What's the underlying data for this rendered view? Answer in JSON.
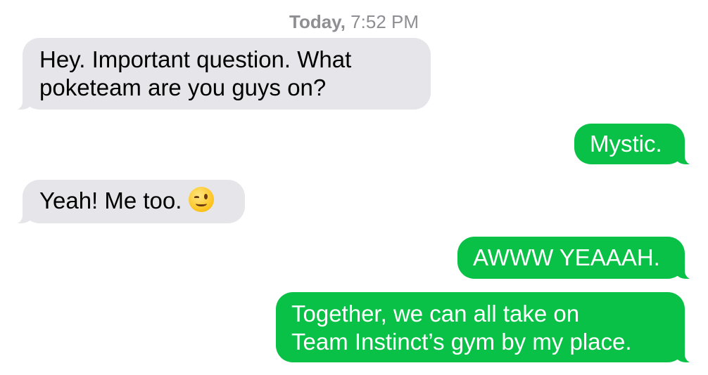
{
  "header": {
    "day": "Today,",
    "time": "7:52 PM"
  },
  "messages": [
    {
      "direction": "incoming",
      "lines": [
        "Hey. Important question. What",
        "poketeam are you guys on?"
      ]
    },
    {
      "direction": "outgoing",
      "lines": [
        "Mystic."
      ]
    },
    {
      "direction": "incoming",
      "lines": [
        "Yeah! Me too."
      ],
      "emoji": "winking-face-emoji"
    },
    {
      "direction": "outgoing",
      "lines": [
        "AWWW YEAAAH."
      ]
    },
    {
      "direction": "outgoing",
      "lines": [
        "Together, we can all take on",
        "Team Instinct’s gym by my place."
      ]
    }
  ],
  "colors": {
    "incoming_bubble": "#e5e5ea",
    "outgoing_bubble": "#09c146",
    "timestamp_text": "#8e8e93"
  }
}
